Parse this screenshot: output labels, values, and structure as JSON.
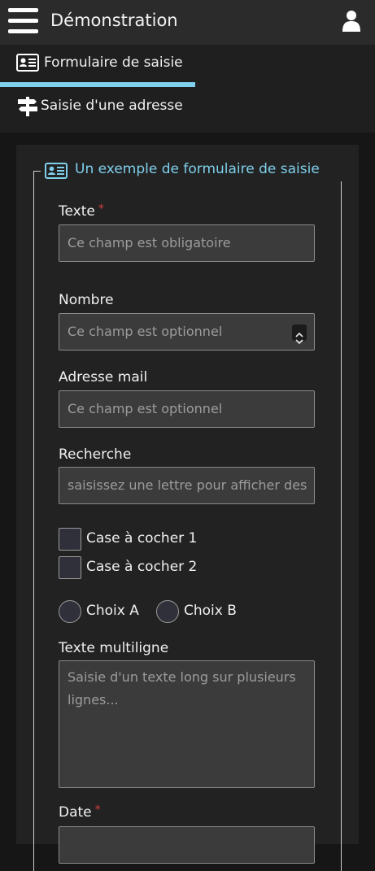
{
  "app": {
    "title": "Démonstration"
  },
  "icons": {
    "menu": "hamburger-icon",
    "user": "user-icon",
    "form": "id-card-icon",
    "address": "signpost-icon"
  },
  "colors": {
    "accent": "#7fd0ec",
    "required": "#d43f3f"
  },
  "tabs": [
    {
      "label": "Formulaire de saisie",
      "active": true
    },
    {
      "label": "Saisie d'une adresse",
      "active": false
    }
  ],
  "form": {
    "legend": "Un exemple de formulaire de saisie",
    "text_field": {
      "label": "Texte",
      "required_mark": "*",
      "placeholder": "Ce champ est obligatoire"
    },
    "number_field": {
      "label": "Nombre",
      "placeholder": "Ce champ est optionnel"
    },
    "email_field": {
      "label": "Adresse mail",
      "placeholder": "Ce champ est optionnel"
    },
    "search_field": {
      "label": "Recherche",
      "placeholder": "saisissez une lettre pour afficher des"
    },
    "checkboxes": [
      {
        "label": "Case à cocher 1",
        "checked": false
      },
      {
        "label": "Case à cocher 2",
        "checked": false
      }
    ],
    "radios": [
      {
        "label": "Choix A",
        "selected": false
      },
      {
        "label": "Choix B",
        "selected": false
      }
    ],
    "multiline_field": {
      "label": "Texte multiligne",
      "placeholder": "Saisie d'un texte long sur plusieurs lignes..."
    },
    "date_field": {
      "label": "Date",
      "required_mark": "*"
    }
  }
}
